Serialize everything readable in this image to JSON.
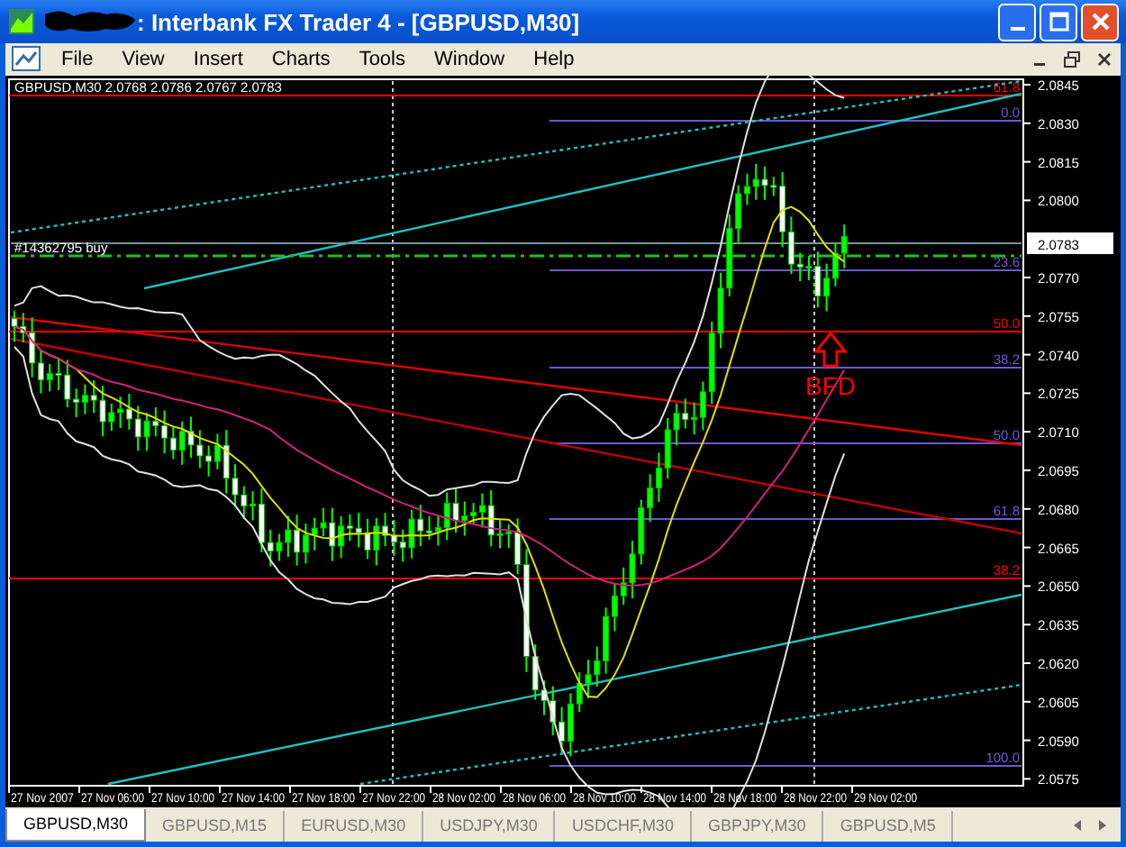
{
  "window": {
    "title": ": Interbank FX Trader 4 - [GBPUSD,M30]"
  },
  "menu": [
    "File",
    "View",
    "Insert",
    "Charts",
    "Tools",
    "Window",
    "Help"
  ],
  "chart": {
    "info": "GBPUSD,M30  2.0768 2.0786 2.0767 2.0783",
    "order": "#14362795 buy",
    "current_price": "2.0783",
    "annotation": "BFD",
    "price_axis": [
      "2.0845",
      "2.0830",
      "2.0815",
      "2.0800",
      "2.0770",
      "2.0755",
      "2.0740",
      "2.0725",
      "2.0710",
      "2.0695",
      "2.0680",
      "2.0665",
      "2.0650",
      "2.0635",
      "2.0620",
      "2.0605",
      "2.0590",
      "2.0575"
    ],
    "time_axis": [
      "27 Nov 2007",
      "27 Nov 06:00",
      "27 Nov 10:00",
      "27 Nov 14:00",
      "27 Nov 18:00",
      "27 Nov 22:00",
      "28 Nov 02:00",
      "28 Nov 06:00",
      "28 Nov 10:00",
      "28 Nov 14:00",
      "28 Nov 18:00",
      "28 Nov 22:00",
      "29 Nov 02:00"
    ],
    "fib_levels": [
      {
        "label": "61.8",
        "color": "#ff0000"
      },
      {
        "label": "0.0",
        "color": "#6a5acd"
      },
      {
        "label": "23.6",
        "color": "#6a5acd"
      },
      {
        "label": "50.0",
        "color": "#ff0000"
      },
      {
        "label": "38.2",
        "color": "#6a5acd"
      },
      {
        "label": "50.0",
        "color": "#6a5acd"
      },
      {
        "label": "61.8",
        "color": "#6a5acd"
      },
      {
        "label": "38.2",
        "color": "#ff0000"
      },
      {
        "label": "100.0",
        "color": "#6a5acd"
      }
    ]
  },
  "tabs": [
    {
      "label": "GBPUSD,M30",
      "selected": true
    },
    {
      "label": "GBPUSD,M15",
      "selected": false
    },
    {
      "label": "EURUSD,M30",
      "selected": false
    },
    {
      "label": "USDJPY,M30",
      "selected": false
    },
    {
      "label": "USDCHF,M30",
      "selected": false
    },
    {
      "label": "GBPJPY,M30",
      "selected": false
    },
    {
      "label": "GBPUSD,M5",
      "selected": false
    }
  ]
}
